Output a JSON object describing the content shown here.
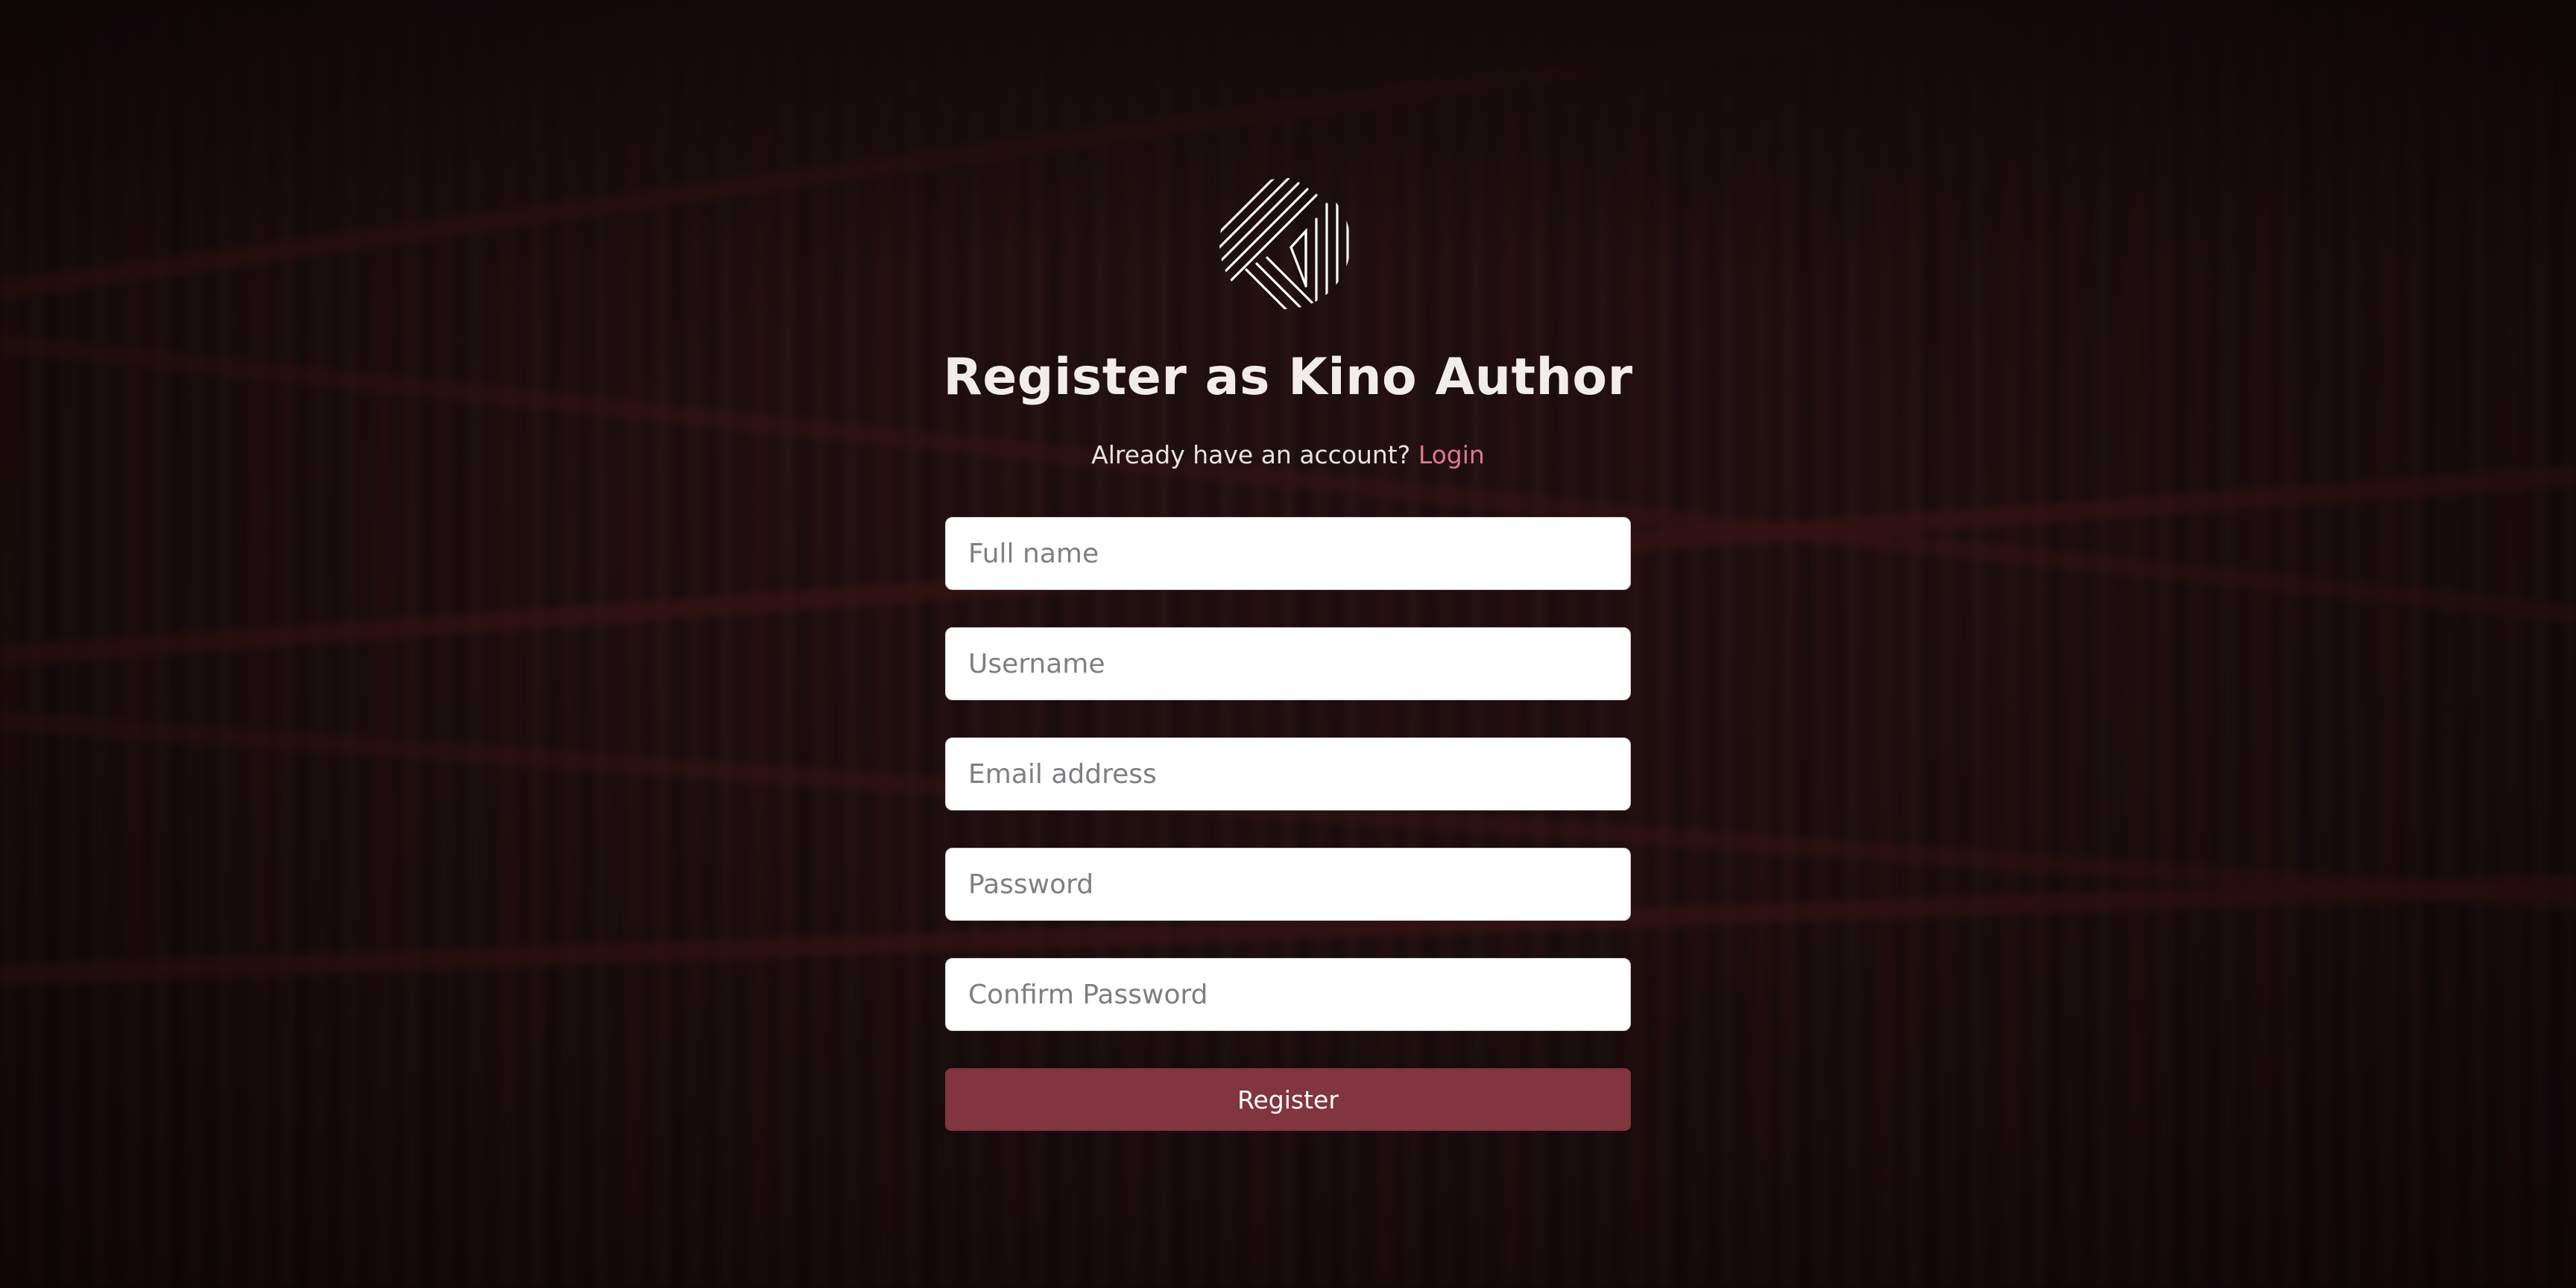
{
  "background": {
    "description_icon": "library-bookshelves-background",
    "overlay_color": "#140a0b"
  },
  "logo": {
    "icon": "kino-striped-circle-logo"
  },
  "header": {
    "title": "Register as Kino Author",
    "prompt_text": "Already have an account?",
    "login_link": "Login"
  },
  "form": {
    "full_name": {
      "placeholder": "Full name",
      "value": ""
    },
    "username": {
      "placeholder": "Username",
      "value": ""
    },
    "email": {
      "placeholder": "Email address",
      "value": ""
    },
    "password": {
      "placeholder": "Password",
      "value": ""
    },
    "confirm_password": {
      "placeholder": "Confirm Password",
      "value": ""
    },
    "submit_label": "Register"
  },
  "colors": {
    "accent": "#82343f",
    "link": "#e0788a",
    "title_text": "#f2ecec"
  }
}
